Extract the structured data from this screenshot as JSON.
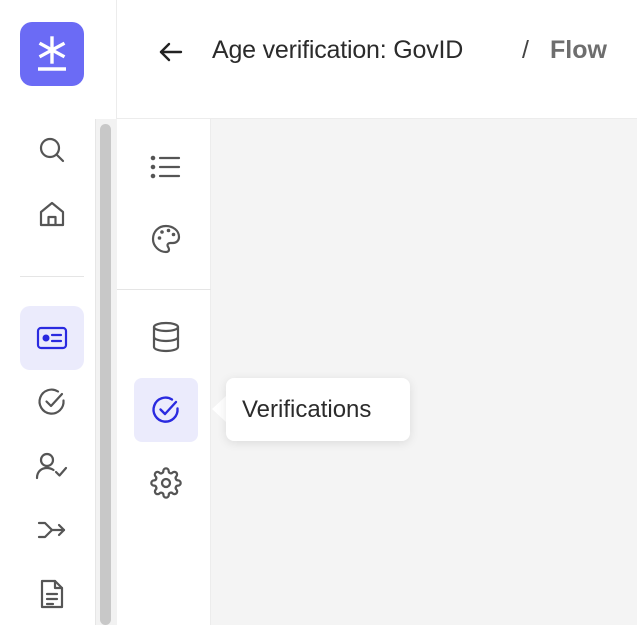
{
  "header": {
    "title": "Age verification: GovID",
    "separator": "/",
    "current": "Flow"
  },
  "rail": {
    "items": [
      {
        "icon": "search-icon"
      },
      {
        "icon": "home-icon"
      },
      {
        "icon": "id-card-icon",
        "active": true
      },
      {
        "icon": "check-circle-icon"
      },
      {
        "icon": "user-check-icon"
      },
      {
        "icon": "merge-arrow-icon"
      },
      {
        "icon": "document-icon"
      }
    ]
  },
  "subnav": {
    "items": [
      {
        "icon": "list-icon"
      },
      {
        "icon": "palette-icon"
      },
      {
        "icon": "database-icon"
      },
      {
        "icon": "check-circle-icon",
        "active": true
      },
      {
        "icon": "gear-icon"
      }
    ]
  },
  "tooltip": {
    "text": "Verifications"
  },
  "colors": {
    "accent": "#6b6bf5",
    "active_icon": "#2a2ae0",
    "active_bg": "#ebebfc",
    "icon": "#555555",
    "canvas_bg": "#f4f4f4"
  }
}
